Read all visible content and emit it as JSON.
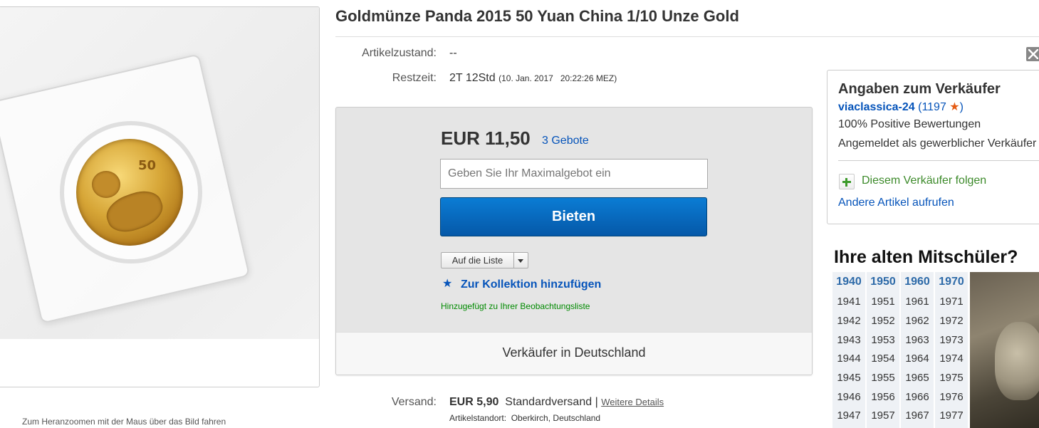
{
  "item": {
    "title": "Goldmünze Panda 2015 50 Yuan China 1/10 Unze Gold",
    "zoom_hint": "Zum Heranzoomen mit der Maus über das Bild fahren",
    "coin_numeral": "50"
  },
  "details": {
    "condition_label": "Artikelzustand:",
    "condition_value": "--",
    "time_label": "Restzeit:",
    "time_value": "2T 12Std",
    "time_end": "(10. Jan. 2017   20:22:26 MEZ)"
  },
  "bid": {
    "price": "EUR 11,50",
    "bids_count": "3 Gebote",
    "input_placeholder": "Geben Sie Ihr Maximalgebot ein",
    "bid_button": "Bieten",
    "list_button": "Auf die Liste",
    "collection_link": "Zur Kollektion hinzufügen",
    "watchlist_msg": "Hinzugefügt zu Ihrer Beobachtungsliste",
    "seller_location": "Verkäufer in Deutschland"
  },
  "shipping": {
    "label": "Versand:",
    "price": "EUR 5,90",
    "method": "Standardversand |",
    "details_link": "Weitere Details",
    "location_label": "Artikelstandort:",
    "location_value": "Oberkirch, Deutschland"
  },
  "seller": {
    "heading": "Angaben zum Verkäufer",
    "name": "viaclassica-24",
    "score_open": "(",
    "score": "1197",
    "score_close": ")",
    "positive": "100% Positive Bewertungen",
    "registered": "Angemeldet als gewerblicher Verkäufer",
    "follow": "Diesem Verkäufer folgen",
    "other_items": "Andere Artikel aufrufen"
  },
  "ad": {
    "title": "Ihre alten Mitschüler?",
    "columns": [
      {
        "head": "1940",
        "years": [
          "1941",
          "1942",
          "1943",
          "1944",
          "1945",
          "1946",
          "1947"
        ]
      },
      {
        "head": "1950",
        "years": [
          "1951",
          "1952",
          "1953",
          "1954",
          "1955",
          "1956",
          "1957"
        ]
      },
      {
        "head": "1960",
        "years": [
          "1961",
          "1962",
          "1963",
          "1964",
          "1965",
          "1966",
          "1967"
        ]
      },
      {
        "head": "1970",
        "years": [
          "1971",
          "1972",
          "1973",
          "1974",
          "1975",
          "1976",
          "1977"
        ]
      }
    ]
  },
  "colors": {
    "link_blue": "#0654ba",
    "bid_button": "#0558a8",
    "success_green": "#008a00",
    "star_orange": "#e55b13"
  }
}
